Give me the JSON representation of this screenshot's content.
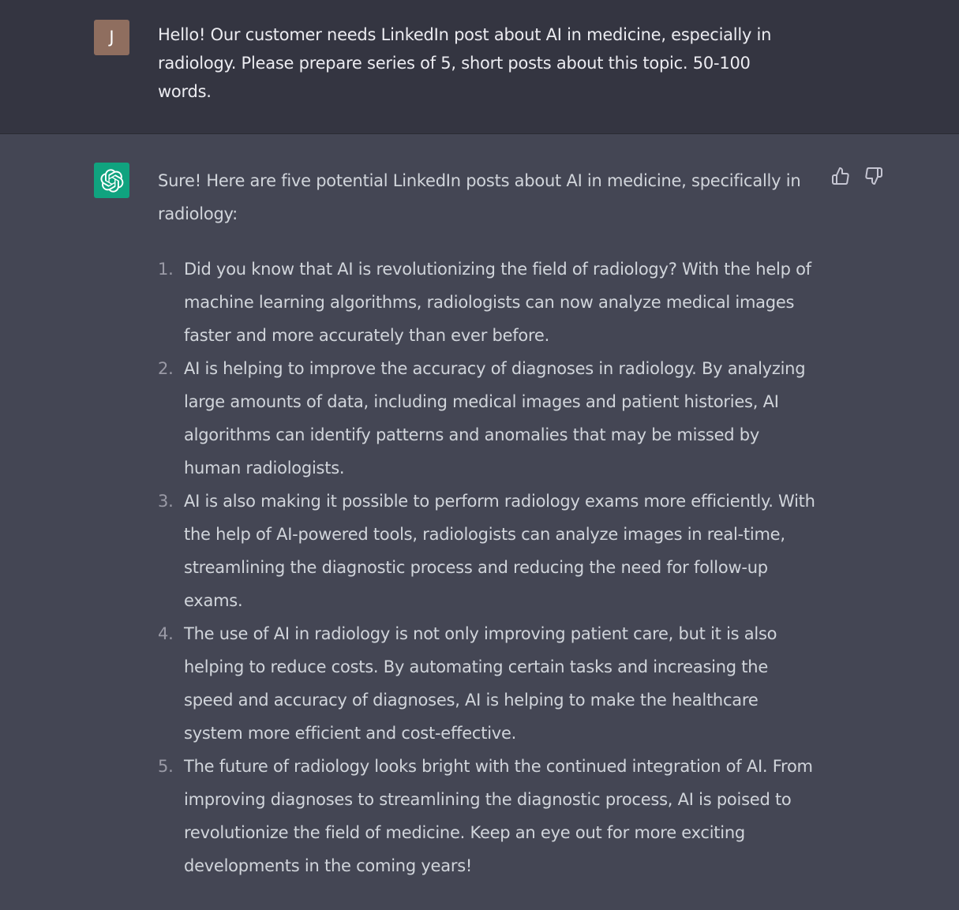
{
  "user_message": {
    "avatar_initial": "J",
    "text": "Hello! Our customer needs LinkedIn post about AI in medicine, especially in radiology. Please prepare series of 5, short posts about this topic. 50-100 words."
  },
  "assistant_message": {
    "intro": "Sure! Here are five potential LinkedIn posts about AI in medicine, specifically in radiology:",
    "items": [
      {
        "num": "1.",
        "text": "Did you know that AI is revolutionizing the field of radiology? With the help of machine learning algorithms, radiologists can now analyze medical images faster and more accurately than ever before."
      },
      {
        "num": "2.",
        "text": "AI is helping to improve the accuracy of diagnoses in radiology. By analyzing large amounts of data, including medical images and patient histories, AI algorithms can identify patterns and anomalies that may be missed by human radiologists."
      },
      {
        "num": "3.",
        "text": "AI is also making it possible to perform radiology exams more efficiently. With the help of AI-powered tools, radiologists can analyze images in real-time, streamlining the diagnostic process and reducing the need for follow-up exams."
      },
      {
        "num": "4.",
        "text": "The use of AI in radiology is not only improving patient care, but it is also helping to reduce costs. By automating certain tasks and increasing the speed and accuracy of diagnoses, AI is helping to make the healthcare system more efficient and cost-effective."
      },
      {
        "num": "5.",
        "text": "The future of radiology looks bright with the continued integration of AI. From improving diagnoses to streamlining the diagnostic process, AI is poised to revolutionize the field of medicine. Keep an eye out for more exciting developments in the coming years!"
      }
    ]
  },
  "icons": {
    "user_avatar": "user-avatar",
    "assistant_avatar": "openai-logo-icon",
    "thumbs_up": "thumbs-up-icon",
    "thumbs_down": "thumbs-down-icon"
  },
  "colors": {
    "user_bg": "#343541",
    "assistant_bg": "#444654",
    "user_avatar_bg": "#8f6e5f",
    "assistant_avatar_bg": "#10a37f"
  }
}
